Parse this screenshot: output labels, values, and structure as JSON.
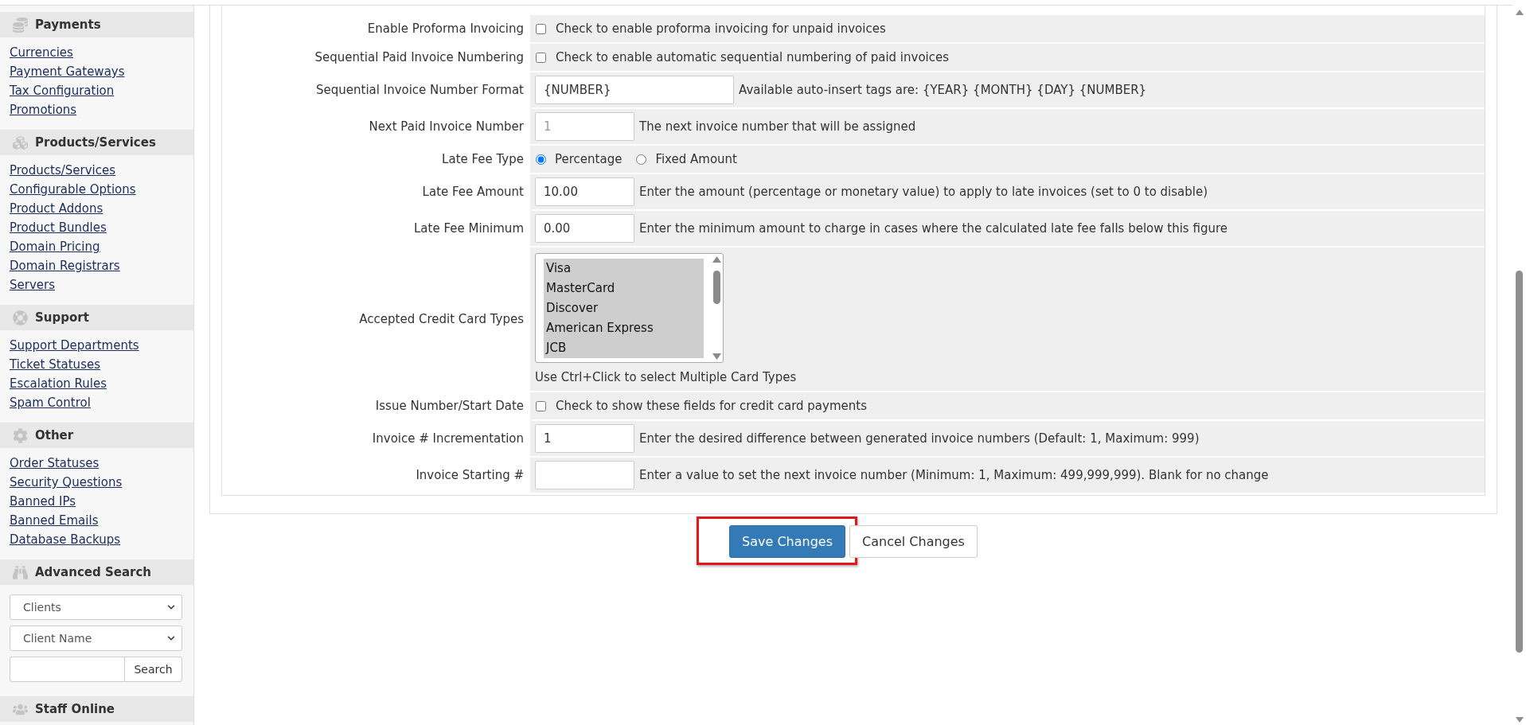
{
  "sidebar": {
    "sections": [
      {
        "kind": "links",
        "title": "Payments",
        "links": [
          "Currencies",
          "Payment Gateways",
          "Tax Configuration",
          "Promotions"
        ]
      },
      {
        "kind": "links",
        "title": "Products/Services",
        "links": [
          "Products/Services",
          "Configurable Options",
          "Product Addons",
          "Product Bundles",
          "Domain Pricing",
          "Domain Registrars",
          "Servers"
        ]
      },
      {
        "kind": "links",
        "title": "Support",
        "links": [
          "Support Departments",
          "Ticket Statuses",
          "Escalation Rules",
          "Spam Control"
        ]
      },
      {
        "kind": "links",
        "title": "Other",
        "links": [
          "Order Statuses",
          "Security Questions",
          "Banned IPs",
          "Banned Emails",
          "Database Backups"
        ]
      },
      {
        "kind": "search",
        "title": "Advanced Search",
        "selects": [
          "Clients",
          "Client Name"
        ],
        "button": "Search"
      },
      {
        "kind": "staff",
        "title": "Staff Online"
      }
    ]
  },
  "form": {
    "rows": [
      {
        "kind": "checkbox",
        "label": "Enable Proforma Invoicing",
        "checked": false,
        "text": "Check to enable proforma invoicing for unpaid invoices"
      },
      {
        "kind": "checkbox",
        "label": "Sequential Paid Invoice Numbering",
        "checked": false,
        "text": "Check to enable automatic sequential numbering of paid invoices"
      },
      {
        "kind": "text",
        "label": "Sequential Invoice Number Format",
        "value": "{NUMBER}",
        "help": "Available auto-insert tags are: {YEAR} {MONTH} {DAY} {NUMBER}"
      },
      {
        "kind": "number",
        "label": "Next Paid Invoice Number",
        "placeholder": "1",
        "help": "The next invoice number that will be assigned"
      },
      {
        "kind": "radio",
        "label": "Late Fee Type",
        "options": [
          {
            "label": "Percentage",
            "selected": true
          },
          {
            "label": "Fixed Amount",
            "selected": false
          }
        ]
      },
      {
        "kind": "number",
        "label": "Late Fee Amount",
        "value": "10.00",
        "help": "Enter the amount (percentage or monetary value) to apply to late invoices (set to 0 to disable)"
      },
      {
        "kind": "number",
        "label": "Late Fee Minimum",
        "value": "0.00",
        "help": "Enter the minimum amount to charge in cases where the calculated late fee falls below this figure"
      },
      {
        "kind": "listbox",
        "label": "Accepted Credit Card Types",
        "options": [
          {
            "label": "Visa",
            "selected": true
          },
          {
            "label": "MasterCard",
            "selected": true
          },
          {
            "label": "Discover",
            "selected": true
          },
          {
            "label": "American Express",
            "selected": true
          },
          {
            "label": "JCB",
            "selected": true
          }
        ],
        "help": "Use Ctrl+Click to select Multiple Card Types"
      },
      {
        "kind": "checkbox",
        "label": "Issue Number/Start Date",
        "checked": false,
        "text": "Check to show these fields for credit card payments"
      },
      {
        "kind": "number",
        "label": "Invoice # Incrementation",
        "value": "1",
        "help": "Enter the desired difference between generated invoice numbers (Default: 1, Maximum: 999)"
      },
      {
        "kind": "number",
        "label": "Invoice Starting #",
        "help": "Enter a value to set the next invoice number (Minimum: 1, Maximum: 499,999,999). Blank for no change"
      }
    ]
  },
  "buttons": [
    {
      "kind": "primary",
      "label": "Save Changes",
      "highlighted": true
    },
    {
      "kind": "default",
      "label": "Cancel Changes",
      "highlighted": false
    }
  ]
}
